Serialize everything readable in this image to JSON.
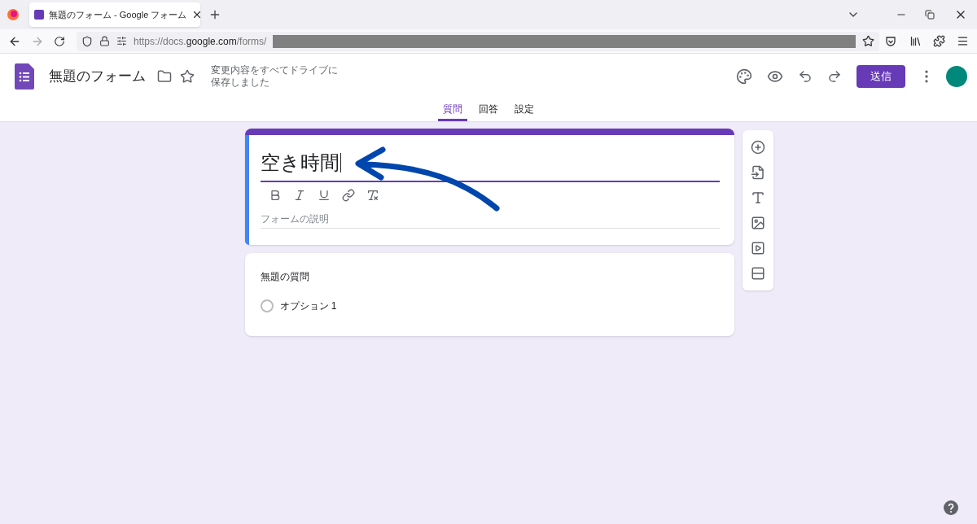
{
  "browser": {
    "tab_title": "無題のフォーム - Google フォーム",
    "url": {
      "prefix": "https://docs.",
      "domain": "google.com",
      "path": "/forms/"
    }
  },
  "header": {
    "title": "無題のフォーム",
    "save_status": [
      "変更内容をすべてドライブに",
      "保存しました"
    ],
    "send_button": "送信"
  },
  "tabs": [
    {
      "label": "質問",
      "selected": true
    },
    {
      "label": "回答",
      "selected": false
    },
    {
      "label": "設定",
      "selected": false
    }
  ],
  "form": {
    "title": "空き時間",
    "description_placeholder": "フォームの説明"
  },
  "question": {
    "title": "無題の質問",
    "options": [
      {
        "label": "オプション 1",
        "selected": false
      }
    ]
  }
}
